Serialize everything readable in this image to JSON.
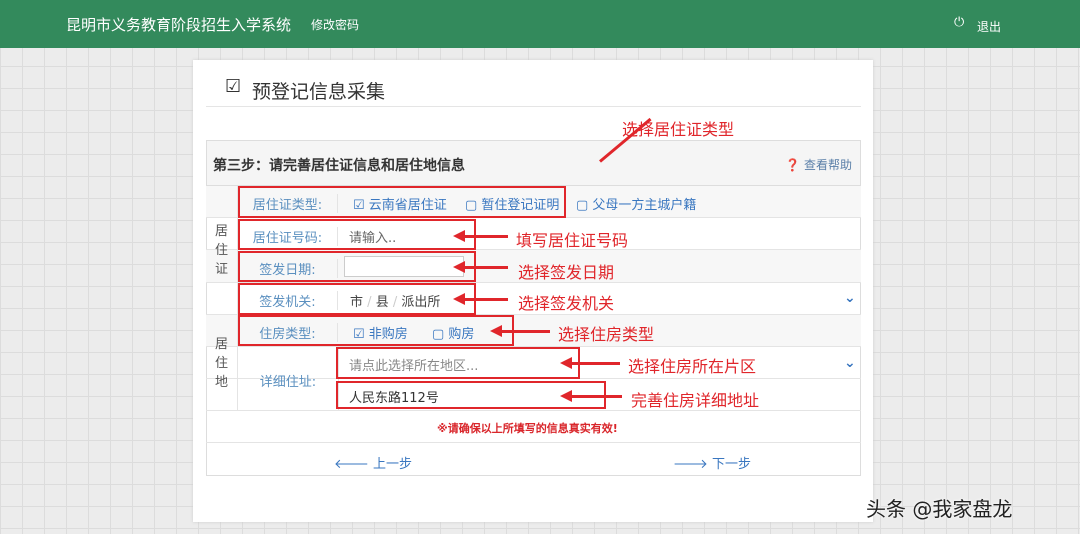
{
  "header": {
    "title": "昆明市义务教育阶段招生入学系统",
    "change_password": "修改密码",
    "logout": "退出"
  },
  "page": {
    "title": "预登记信息采集"
  },
  "panel": {
    "step": "第三步：请完善居住证信息和居住地信息",
    "help": "查看帮助",
    "group_permit": "居住证",
    "group_residence": "居住地",
    "permit_type": {
      "label": "居住证类型:",
      "options": [
        {
          "label": "云南省居住证",
          "checked": true
        },
        {
          "label": "暂住登记证明",
          "checked": false
        },
        {
          "label": "父母一方主城户籍",
          "checked": false
        }
      ]
    },
    "permit_number": {
      "label": "居住证号码:",
      "placeholder": "请输入.."
    },
    "issue_date": {
      "label": "签发日期:",
      "value": ""
    },
    "issuer": {
      "label": "签发机关:",
      "city": "市",
      "county": "县",
      "station": "派出所",
      "sep": "/"
    },
    "housing_type": {
      "label": "住房类型:",
      "options": [
        {
          "label": "非购房",
          "checked": true
        },
        {
          "label": "购房",
          "checked": false
        }
      ]
    },
    "address": {
      "label": "详细住址:",
      "area_placeholder": "请点此选择所在地区...",
      "detail": "人民东路112号"
    },
    "notice": "※请确保以上所填写的信息真实有效!",
    "prev": "上一步",
    "next": "下一步"
  },
  "annotations": [
    "选择居住证类型",
    "填写居住证号码",
    "选择签发日期",
    "选择签发机关",
    "选择住房类型",
    "选择住房所在片区",
    "完善住房详细地址"
  ],
  "watermark": "头条 @我家盘龙"
}
